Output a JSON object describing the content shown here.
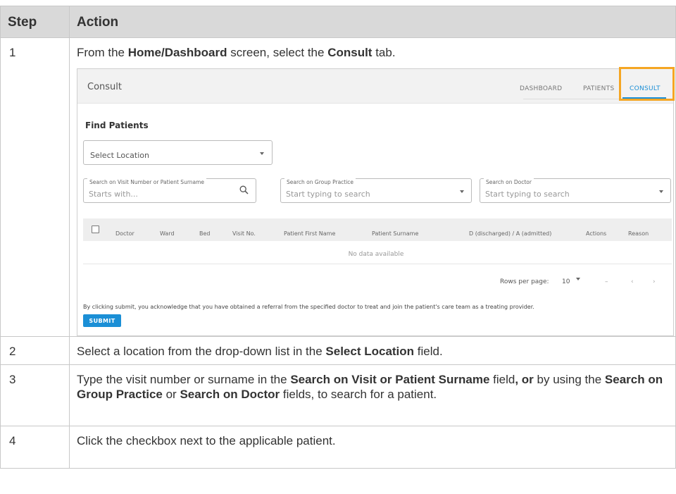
{
  "table": {
    "headers": [
      "Step",
      "Action"
    ],
    "rows": [
      {
        "step": "1",
        "parts": [
          "From the ",
          "Home/Dashboard",
          " screen, select the ",
          "Consult",
          " tab."
        ]
      },
      {
        "step": "2",
        "parts": [
          "Select a location from the drop-down list in the ",
          "Select Location",
          " field."
        ]
      },
      {
        "step": "3",
        "parts": [
          "Type the visit number or surname in the ",
          "Search on Visit or Patient Surname",
          " field",
          ", or",
          " by using the ",
          "Search on Group Practice",
          " or ",
          "Search on Doctor",
          " fields, to search for a patient."
        ]
      },
      {
        "step": "4",
        "parts": [
          "Click the checkbox next to the applicable patient."
        ]
      }
    ]
  },
  "screenshot": {
    "title": "Consult",
    "tabs": [
      "DASHBOARD",
      "PATIENTS",
      "CONSULT"
    ],
    "active_tab": "CONSULT",
    "highlight_color": "#f5a623",
    "accent_color": "#1b8fd6",
    "find_heading": "Find Patients",
    "location_select": "Select Location",
    "fields": [
      {
        "label": "Search on Visit Number or Patient Surname",
        "placeholder": "Starts with...",
        "icon": "search-icon"
      },
      {
        "label": "Search on Group Practice",
        "placeholder": "Start typing to search",
        "icon": "chevron-down-icon"
      },
      {
        "label": "Search on Doctor",
        "placeholder": "Start typing to search",
        "icon": "chevron-down-icon"
      }
    ],
    "columns": [
      "Doctor",
      "Ward",
      "Bed",
      "Visit No.",
      "Patient First Name",
      "Patient Surname",
      "D (discharged) / A (admitted)",
      "Actions",
      "Reason"
    ],
    "no_data": "No data available",
    "rows_per_page_label": "Rows per page:",
    "rows_per_page_value": "10",
    "range_text": "–",
    "acknowledgement": "By clicking submit, you acknowledge that you have obtained a referral from the specified doctor to treat and join the patient's care team as a treating provider.",
    "submit_label": "SUBMIT"
  }
}
